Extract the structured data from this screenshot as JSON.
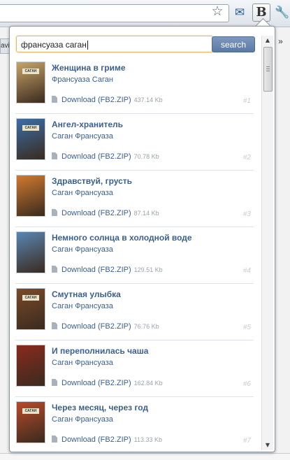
{
  "browser": {
    "left_tab_fragment": "avi",
    "overflow_label": "»",
    "star_icon": "star-icon",
    "mail_icon": "mail-icon",
    "extension_button_label": "B",
    "wrench_icon": "wrench-icon"
  },
  "search": {
    "query": "франсуаза саган",
    "button_label": "search"
  },
  "results": [
    {
      "title": "Женщина в гриме",
      "author": "Франсуаза Саган",
      "download_label": "Download (FB2.ZIP)",
      "size": "437.14 Kb",
      "index": "#1",
      "cover_label": "САГАН",
      "cover_color": "#c8a46a"
    },
    {
      "title": "Ангел-хранитель",
      "author": "Саган Франсуаза",
      "download_label": "Download (FB2.ZIP)",
      "size": "70.78 Kb",
      "index": "#2",
      "cover_label": "САГАН",
      "cover_color": "#3b6ea6"
    },
    {
      "title": "Здравствуй, грусть",
      "author": "Саган Франсуаза",
      "download_label": "Download (FB2.ZIP)",
      "size": "87.14 Kb",
      "index": "#3",
      "cover_label": "",
      "cover_color": "#d07a2e"
    },
    {
      "title": "Немного солнца в холодной воде",
      "author": "Саган Франсуаза",
      "download_label": "Download (FB2.ZIP)",
      "size": "129.51 Kb",
      "index": "#4",
      "cover_label": "",
      "cover_color": "#5a86b4"
    },
    {
      "title": "Смутная улыбка",
      "author": "Саган Франсуаза",
      "download_label": "Download (FB2.ZIP)",
      "size": "76.76 Kb",
      "index": "#5",
      "cover_label": "САГАН",
      "cover_color": "#7a4a2a"
    },
    {
      "title": "И переполнилась чаша",
      "author": "Саган Франсуаза",
      "download_label": "Download (FB2.ZIP)",
      "size": "162.84 Kb",
      "index": "#6",
      "cover_label": "",
      "cover_color": "#8a2a1e"
    },
    {
      "title": "Через месяц, через год",
      "author": "Саган Франсуаза",
      "download_label": "Download (FB2.ZIP)",
      "size": "113.33 Kb",
      "index": "#7",
      "cover_label": "САГАН",
      "cover_color": "#b84a2a"
    }
  ],
  "colors": {
    "link": "#3b5f8f",
    "accent": "#5a7aa5",
    "input_focus": "#e3b86b"
  }
}
